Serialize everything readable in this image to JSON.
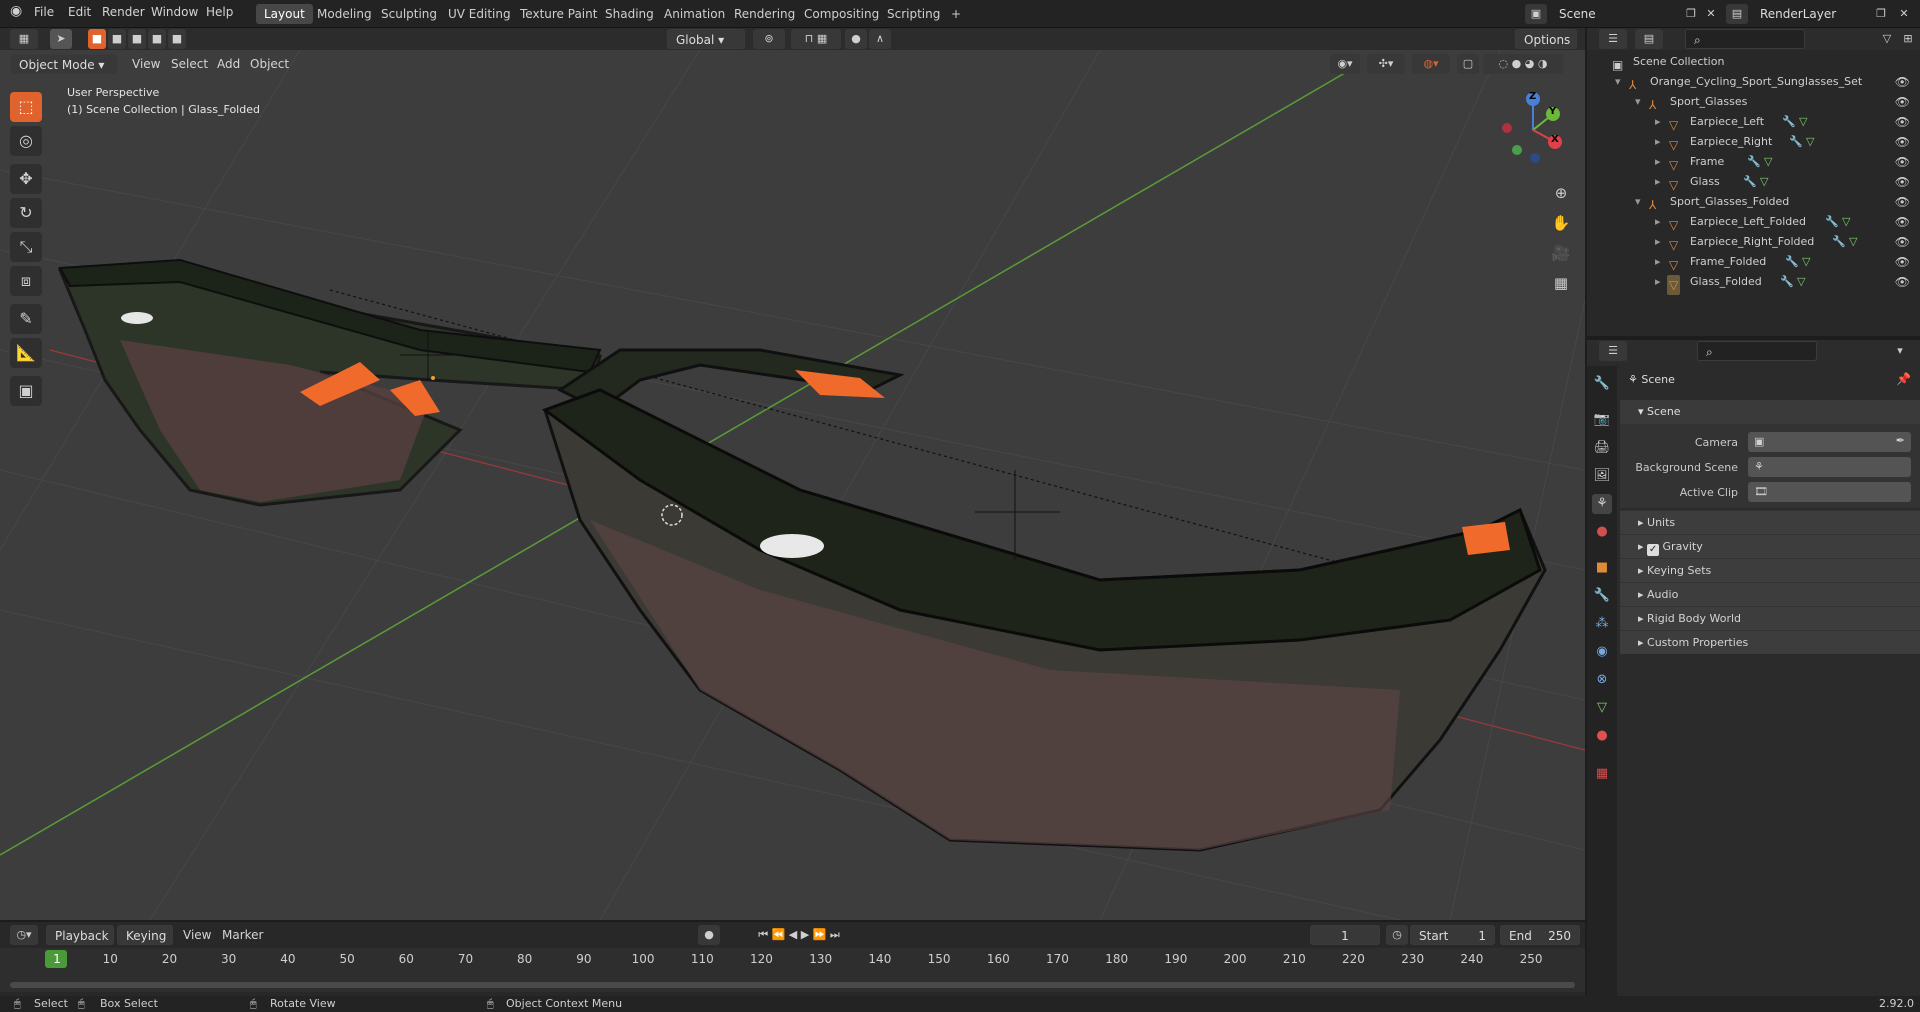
{
  "topbar": {
    "menus": [
      "File",
      "Edit",
      "Render",
      "Window",
      "Help"
    ],
    "workspaces": [
      "Layout",
      "Modeling",
      "Sculpting",
      "UV Editing",
      "Texture Paint",
      "Shading",
      "Animation",
      "Rendering",
      "Compositing",
      "Scripting"
    ],
    "add_tab": "+",
    "scene": "Scene",
    "render_layer": "RenderLayer"
  },
  "viewport": {
    "mode": "Object Mode",
    "menus": [
      "View",
      "Select",
      "Add",
      "Object"
    ],
    "orientation": "Global",
    "options": "Options",
    "overlay_title": "User Perspective",
    "overlay_sub": "(1) Scene Collection | Glass_Folded",
    "axes": {
      "x": "X",
      "y": "Y",
      "z": "Z"
    }
  },
  "outliner": {
    "root": "Scene Collection",
    "set": "Orange_Cycling_Sport_Sunglasses_Set",
    "groups": [
      {
        "name": "Sport_Glasses",
        "items": [
          "Earpiece_Left",
          "Earpiece_Right",
          "Frame",
          "Glass"
        ]
      },
      {
        "name": "Sport_Glasses_Folded",
        "items": [
          "Earpiece_Left_Folded",
          "Earpiece_Right_Folded",
          "Frame_Folded",
          "Glass_Folded"
        ]
      }
    ]
  },
  "properties": {
    "context": "Scene",
    "panel": "Scene",
    "camera_label": "Camera",
    "bg_label": "Background Scene",
    "clip_label": "Active Clip",
    "subpanels": [
      "Units",
      "Gravity",
      "Keying Sets",
      "Audio",
      "Rigid Body World",
      "Custom Properties"
    ]
  },
  "timeline": {
    "menus": [
      "Playback",
      "Keying",
      "View",
      "Marker"
    ],
    "current_frame": "1",
    "start_label": "Start",
    "start": "1",
    "end_label": "End",
    "end": "250",
    "ticks": [
      "1",
      "10",
      "20",
      "30",
      "40",
      "50",
      "60",
      "70",
      "80",
      "90",
      "100",
      "110",
      "120",
      "130",
      "140",
      "150",
      "160",
      "170",
      "180",
      "190",
      "200",
      "210",
      "220",
      "230",
      "240",
      "250"
    ]
  },
  "status": {
    "select": "Select",
    "box_select": "Box Select",
    "rotate": "Rotate View",
    "context_menu": "Object Context Menu",
    "version": "2.92.0"
  },
  "colors": {
    "accent": "#e0622c",
    "orange_pad": "#f06a2c"
  }
}
